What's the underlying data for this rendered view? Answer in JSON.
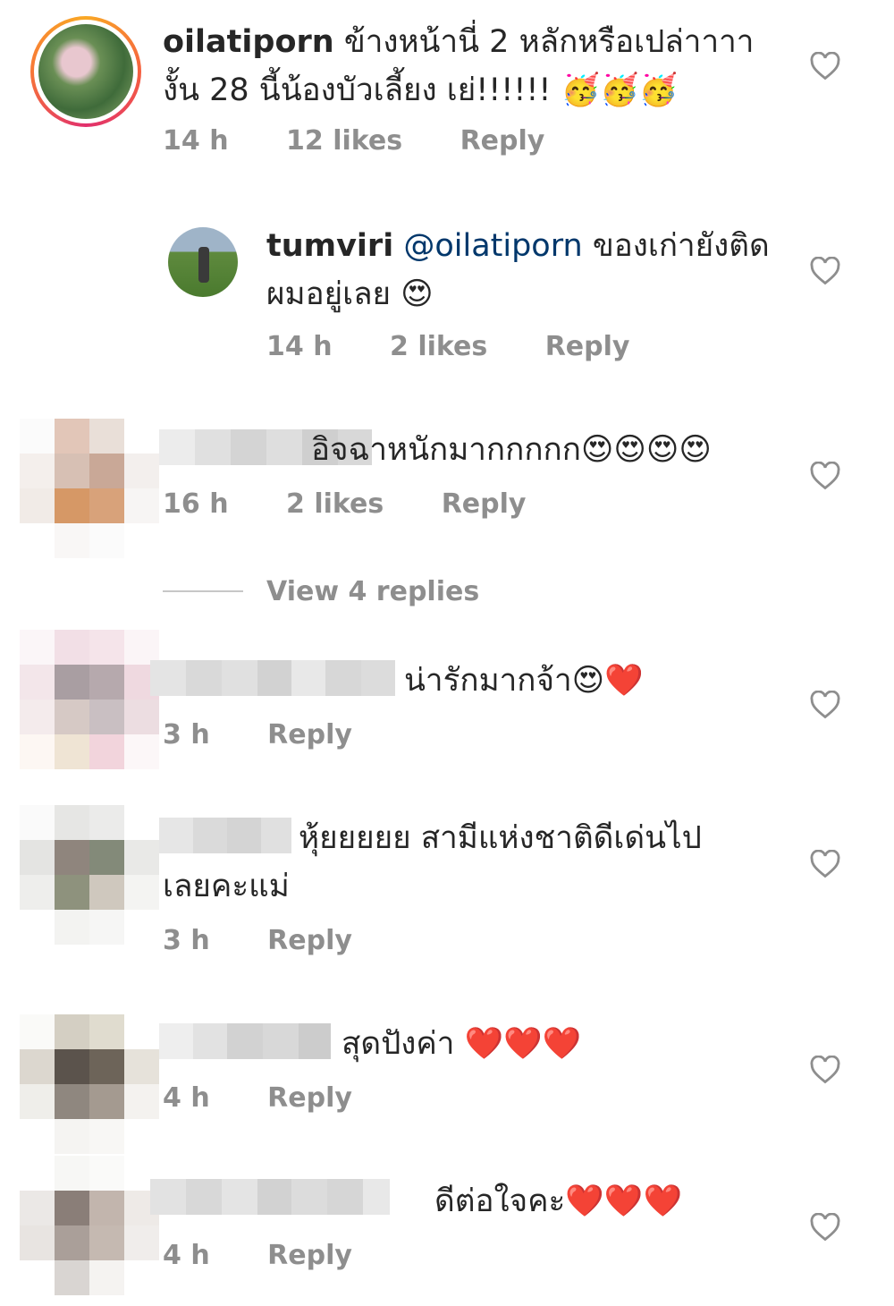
{
  "comments": [
    {
      "username": "oilatiporn",
      "text_line1": "ข้างหน้านี่ 2 หลักหรือเปล่าาาา",
      "text_line2": "งั้น 28 นี้น้องบัวเลี้ยง เย่!!!!!! 🥳🥳🥳",
      "time": "14 h",
      "likes": "12 likes",
      "reply": "Reply"
    },
    {
      "username": "tumviri",
      "mention": "@oilatiporn",
      "text_line1": "ของเก่ายังติด",
      "text_line2": "ผมอยู่เลย 😍",
      "time": "14 h",
      "likes": "2 likes",
      "reply": "Reply"
    },
    {
      "text": "อิจฉาหนักมากกกกก😍😍😍😍",
      "time": "16 h",
      "likes": "2 likes",
      "reply": "Reply",
      "view_replies": "View 4 replies"
    },
    {
      "text": "น่ารักมากจ้า😍❤️",
      "time": "3 h",
      "reply": "Reply"
    },
    {
      "text_line1": "หุ้ยยยยย สามีแห่งชาติดีเด่นไป",
      "text_line2": "เลยคะแม่",
      "time": "3 h",
      "reply": "Reply"
    },
    {
      "text": "สุดปังค่า ❤️❤️❤️",
      "time": "4 h",
      "reply": "Reply"
    },
    {
      "text": "ดีต่อใจคะ❤️❤️❤️",
      "time": "4 h",
      "reply": "Reply"
    }
  ],
  "icons": {
    "like": "heart-outline-icon"
  },
  "colors": {
    "text": "#262626",
    "meta": "#8e8e8e",
    "mention": "#00376b"
  }
}
